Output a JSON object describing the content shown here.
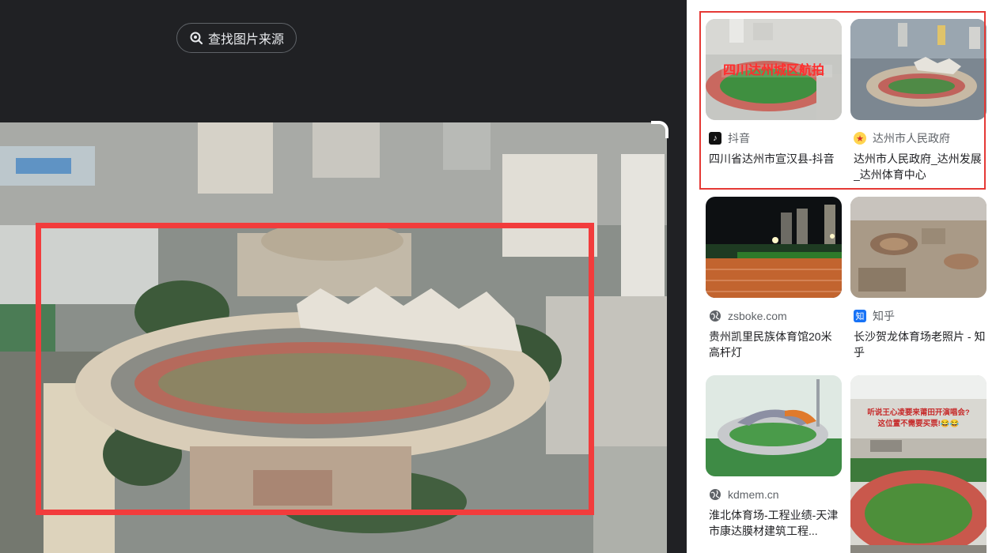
{
  "lens": {
    "find_source_label": "查找图片来源"
  },
  "colors": {
    "panel_bg": "#202124",
    "selection": "#f23c3c",
    "highlight": "#e53935"
  },
  "results": [
    {
      "source": "抖音",
      "source_icon": "tiktok-icon",
      "title": "四川省达州市宣汉县-抖音",
      "thumb_caption": "四川达州城区航拍"
    },
    {
      "source": "达州市人民政府",
      "source_icon": "government-emblem-icon",
      "title": "达州市人民政府_达州发展_达州体育中心"
    },
    {
      "source": "zsboke.com",
      "source_icon": "globe-icon",
      "title": "贵州凯里民族体育馆20米高杆灯"
    },
    {
      "source": "知乎",
      "source_icon": "zhihu-icon",
      "title": "长沙贺龙体育场老照片 - 知乎"
    },
    {
      "source": "kdmem.cn",
      "source_icon": "globe-icon",
      "title": "淮北体育场-工程业绩-天津市康达膜材建筑工程..."
    },
    {
      "source": "",
      "source_icon": "",
      "title": "",
      "thumb_caption": "听说王心凌要来莆田开演唱会?这位置不需要买票!😂😂"
    }
  ]
}
